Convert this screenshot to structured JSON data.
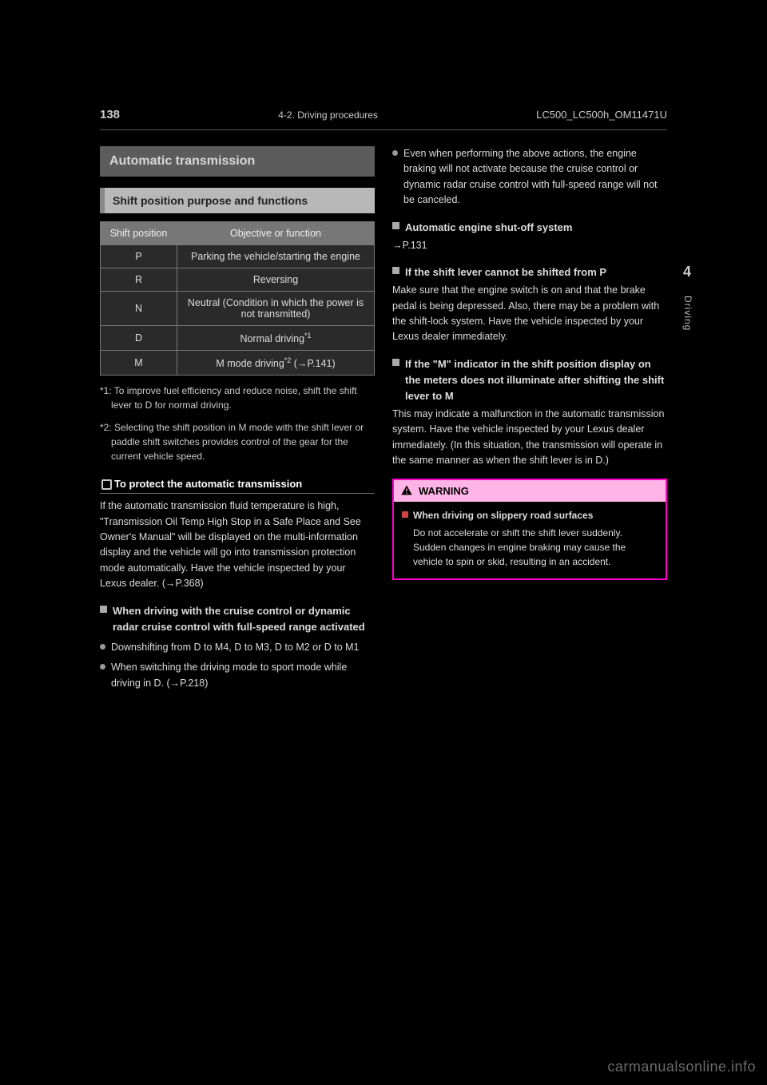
{
  "header": {
    "page_number": "138",
    "section": "4-2. Driving procedures",
    "model_code": "LC500_LC500h_OM11471U"
  },
  "side": {
    "chapter_num": "4",
    "chapter_label": "Driving"
  },
  "left": {
    "topic": "Automatic transmission",
    "subhead": "Shift position purpose and functions",
    "table": {
      "col1": "Shift position",
      "col2": "Objective or function",
      "rows": [
        {
          "pos": "P",
          "desc": "Parking the vehicle/starting the engine"
        },
        {
          "pos": "R",
          "desc": "Reversing"
        },
        {
          "pos": "N",
          "desc": "Neutral (Condition in which the power is not transmitted)"
        },
        {
          "pos": "D",
          "desc_pre": "Normal driving",
          "sup": "*1",
          "desc_post": ""
        },
        {
          "pos": "M",
          "desc_pre": "M mode driving",
          "sup": "*2",
          "desc_post": " (→P.141)"
        }
      ]
    },
    "fn1": "*1: To improve fuel efficiency and reduce noise, shift the shift lever to D for normal driving.",
    "fn2": "*2: Selecting the shift position in M mode with the shift lever or paddle shift switches provides control of the gear for the current vehicle speed.",
    "section_title": "To protect the automatic transmission",
    "para1": "If the automatic transmission fluid temperature is high, \"Transmission Oil Temp High Stop in a Safe Place and See Owner's Manual\" will be displayed on the multi-information display and the vehicle will go into transmission protection mode automatically. Have the vehicle inspected by your Lexus dealer. (→P.368)",
    "note_hd": "When driving with the cruise control or dynamic radar cruise control with full-speed range activated",
    "bullet1": "Downshifting from D to M4, D to M3, D to M2 or D to M1",
    "bullet2": "When switching the driving mode to sport mode while driving in D. (→P.218)"
  },
  "right": {
    "bullet_top": "Even when performing the above actions, the engine braking will not activate because the cruise control or dynamic radar cruise control with full-speed range will not be canceled.",
    "note1_hd": "Automatic engine shut-off system",
    "note1_body": "→P.131",
    "note2_hd": "If the shift lever cannot be shifted from P",
    "note2_body": "Make sure that the engine switch is on and that the brake pedal is being depressed. Also, there may be a problem with the shift-lock system. Have the vehicle inspected by your Lexus dealer immediately.",
    "note3_hd": "If the \"M\" indicator in the shift position display on the meters does not illuminate after shifting the shift lever to M",
    "note3_body": "This may indicate a malfunction in the automatic transmission system. Have the vehicle inspected by your Lexus dealer immediately. (In this situation, the transmission will operate in the same manner as when the shift lever is in D.)",
    "warning_label": "WARNING",
    "warning_hd": "When driving on slippery road surfaces",
    "warning_body": "Do not accelerate or shift the shift lever suddenly. Sudden changes in engine braking may cause the vehicle to spin or skid, resulting in an accident."
  },
  "watermark": "carmanualsonline.info"
}
